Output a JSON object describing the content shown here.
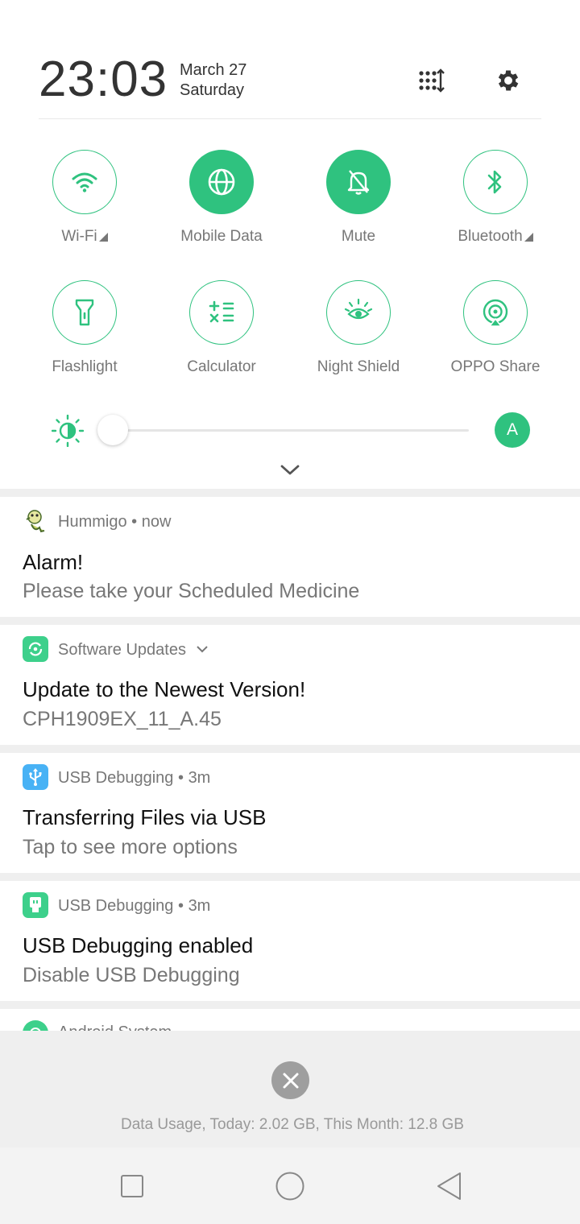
{
  "header": {
    "time": "23:03",
    "date": "March 27",
    "weekday": "Saturday",
    "edit_icon": "edit-tiles-icon",
    "settings_icon": "gear-icon"
  },
  "toggles": [
    {
      "label": "Wi-Fi",
      "icon": "wifi-icon",
      "active": false,
      "has_menu": true
    },
    {
      "label": "Mobile Data",
      "icon": "globe-icon",
      "active": true,
      "has_menu": false
    },
    {
      "label": "Mute",
      "icon": "bell-off-icon",
      "active": true,
      "has_menu": false
    },
    {
      "label": "Bluetooth",
      "icon": "bluetooth-icon",
      "active": false,
      "has_menu": true
    },
    {
      "label": "Flashlight",
      "icon": "flashlight-icon",
      "active": false,
      "has_menu": false
    },
    {
      "label": "Calculator",
      "icon": "calculator-icon",
      "active": false,
      "has_menu": false
    },
    {
      "label": "Night Shield",
      "icon": "eye-icon",
      "active": false,
      "has_menu": false
    },
    {
      "label": "OPPO Share",
      "icon": "share-icon",
      "active": false,
      "has_menu": false
    }
  ],
  "brightness": {
    "level": 0.0,
    "auto_label": "A"
  },
  "notifications": [
    {
      "app": "Hummigo",
      "time": "now",
      "title": "Alarm!",
      "text": "Please take your Scheduled Medicine"
    },
    {
      "app": "Software Updates",
      "time": "",
      "title": "Update to the Newest Version!",
      "text": "CPH1909EX_11_A.45"
    },
    {
      "app": "USB Debugging",
      "time": "3m",
      "title": "Transferring Files via USB",
      "text": "Tap to see more options"
    },
    {
      "app": "USB Debugging",
      "time": "3m",
      "title": "USB Debugging enabled",
      "text": "Disable USB Debugging"
    },
    {
      "app": "Android System",
      "time": "",
      "title": "",
      "text": ""
    }
  ],
  "footer": {
    "data_usage": "Data Usage, Today: 2.02 GB, This Month: 12.8 GB"
  },
  "colors": {
    "accent": "#2fc27f",
    "software_updates": "#3dd08b",
    "usb_transfer": "#48b2f5",
    "usb_debug": "#3dd08b"
  }
}
